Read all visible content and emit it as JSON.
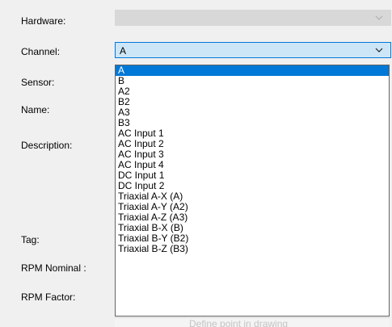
{
  "labels": {
    "hardware": "Hardware:",
    "channel": "Channel:",
    "sensor": "Sensor:",
    "name": "Name:",
    "description": "Description:",
    "tag": "Tag:",
    "rpm_nominal": "RPM Nominal :",
    "rpm_factor": "RPM Factor:"
  },
  "hardware_combo": {
    "value": ""
  },
  "channel_combo": {
    "value": "A"
  },
  "channel_dropdown": {
    "selected": "A",
    "options": [
      "A",
      "B",
      "A2",
      "B2",
      "A3",
      "B3",
      "AC Input 1",
      "AC Input 2",
      "AC Input 3",
      "AC Input 4",
      "DC Input 1",
      "DC Input 2",
      "Triaxial A-X (A)",
      "Triaxial A-Y (A2)",
      "Triaxial A-Z (A3)",
      "Triaxial B-X (B)",
      "Triaxial B-Y (B2)",
      "Triaxial B-Z (B3)"
    ]
  },
  "obscured_text": "Define point in drawing",
  "colors": {
    "selection": "#0078d7",
    "combo_focus_bg": "#cde6f7",
    "disabled_bg": "#d8d8d8",
    "window_bg": "#f0f0f0"
  },
  "icons": {
    "combo_arrow": "chevron-down-icon"
  }
}
